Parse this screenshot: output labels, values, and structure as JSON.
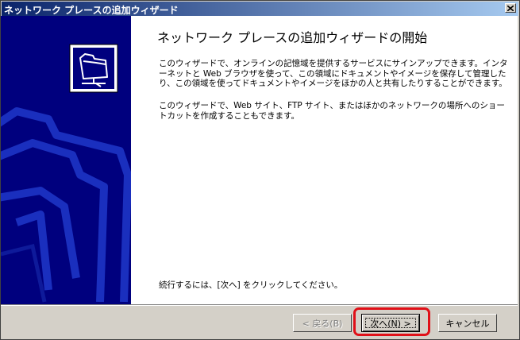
{
  "window": {
    "title": "ネットワーク プレースの追加ウィザード"
  },
  "content": {
    "heading": "ネットワーク プレースの追加ウィザードの開始",
    "paragraph1": "このウィザードで、オンラインの記憶域を提供するサービスにサインアップできます。インターネットと Web ブラウザを使って、この領域にドキュメントやイメージを保存して管理したり、この領域を使ってドキュメントやイメージをほかの人と共有したりすることができます。",
    "paragraph2": "このウィザードで、Web サイト、FTP サイト、またはほかのネットワークの場所へのショートカットを作成することもできます。",
    "continue_text": "続行するには、[次へ] をクリックしてください。"
  },
  "buttons": {
    "back": "< 戻る(B)",
    "next": "次へ(N) >",
    "cancel": "キャンセル"
  },
  "colors": {
    "titlebar_start": "#0a246a",
    "titlebar_end": "#a6caf0",
    "sidebar": "#00007e",
    "highlight": "#e01018"
  },
  "icons": {
    "hero": "network-folder-icon",
    "close": "close-icon"
  }
}
